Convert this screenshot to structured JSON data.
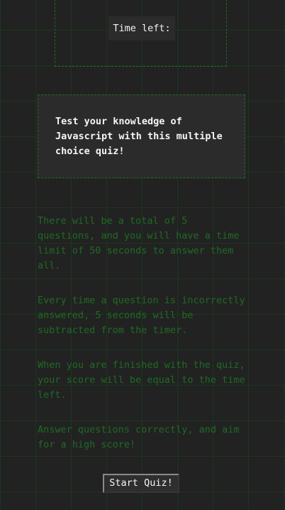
{
  "timer": {
    "label": "Time left:"
  },
  "intro": {
    "text": "Test your knowledge of Javascript with this multiple choice quiz!"
  },
  "rules": {
    "items": [
      "There will be a total of 5 questions, and you will have a time limit of 50 seconds to answer them all.",
      "Every time a question is incorrectly answered, 5 seconds will be subtracted from the timer.",
      "When you are finished with the quiz, your score will be equal to the time left.",
      "Answer questions correctly, and aim for a high score!"
    ]
  },
  "start_button": {
    "label": "Start Quiz!"
  },
  "colors": {
    "background": "#222222",
    "grid": "#145a14",
    "rules_text": "#1e6b24",
    "panel": "#2b2b2b",
    "heading_text": "#f5f5f5"
  }
}
